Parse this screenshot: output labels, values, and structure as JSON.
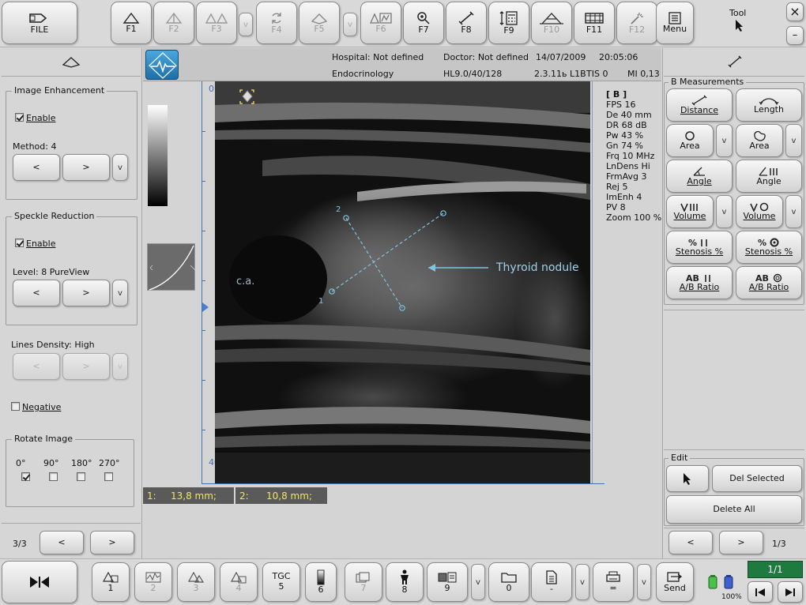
{
  "top_toolbar": {
    "file": "FILE",
    "f_buttons": [
      "F1",
      "F2",
      "F3",
      "F4",
      "F5",
      "F6",
      "F7",
      "F8",
      "F9",
      "F10",
      "F11",
      "F12"
    ],
    "menu": "Menu",
    "tool": "Tool",
    "close": "×",
    "minimize": "–",
    "v": "v"
  },
  "header": {
    "hospital": "Hospital: Not defined",
    "doctor": "Doctor: Not defined",
    "date": "14/07/2009",
    "time": "20:05:06",
    "department": "Endocrinology",
    "probe": "HL9.0/40/128",
    "version": "2.3.11ь L1B",
    "tis": "TIS 0",
    "mi": "MI 0,13"
  },
  "left_panel": {
    "image_enhancement": {
      "title": "Image Enhancement",
      "enable": "Enable",
      "enabled": true,
      "method": "Method: 4"
    },
    "speckle_reduction": {
      "title": "Speckle Reduction",
      "enable": "Enable",
      "enabled": true,
      "level": "Level: 8 PureView"
    },
    "lines_density": "Lines Density: High",
    "negative": {
      "label": "Negative",
      "checked": false
    },
    "rotate_image": {
      "title": "Rotate Image",
      "angles": [
        "0°",
        "90°",
        "180°",
        "270°"
      ],
      "selected": "0°"
    },
    "page": "3/3",
    "prev": "<",
    "next": ">",
    "v": "v"
  },
  "image": {
    "ca_label": "c.a.",
    "nodule_label": "Thyroid nodule",
    "marker_1": "1",
    "marker_2": "2",
    "depth_top": "0",
    "depth_bottom": "40",
    "params": [
      "[ B ]",
      "FPS  16",
      "De   40 mm",
      "DR   68 dB",
      "Pw   43 %",
      "Gn   74 %",
      "Frq   10 MHz",
      "LnDens  Hi",
      "FrmAvg   3",
      "Rej   5",
      "ImEnh   4",
      "PV   8",
      "Zoom   100 %"
    ]
  },
  "measurements": [
    {
      "index": "1:",
      "value": "13,8 mm;"
    },
    {
      "index": "2:",
      "value": "10,8 mm;"
    }
  ],
  "right_panel": {
    "title": "B Measurements",
    "buttons": [
      "Distance",
      "Length",
      "Area",
      "Area",
      "Angle",
      "Angle",
      "Volume",
      "Volume",
      "Stenosis %",
      "Stenosis %",
      "A/B Ratio",
      "A/B Ratio"
    ],
    "edit_title": "Edit",
    "del_selected": "Del Selected",
    "delete_all": "Delete All",
    "page": "1/1",
    "page2": "1/3",
    "prev": "<",
    "next": ">",
    "v": "v"
  },
  "bottom_toolbar": {
    "numbers": [
      "1",
      "2",
      "3",
      "4",
      "5",
      "6",
      "7",
      "8",
      "9",
      "0",
      "-",
      "="
    ],
    "tgc": "TGC",
    "send": "Send",
    "battery": "100%",
    "page": "1/1",
    "v": "v"
  },
  "colors": {
    "accent_yellow": "#f2e65a",
    "measure_line": "#7fc4e0",
    "page_green": "#1e7a3e"
  }
}
